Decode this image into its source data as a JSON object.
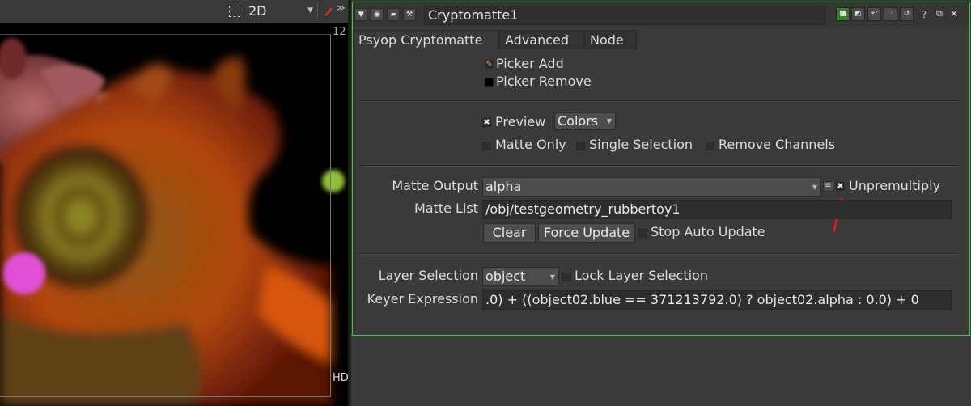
{
  "viewer": {
    "view_mode": "2D",
    "frame_top_label": "12",
    "frame_bottom_label": "HD"
  },
  "node": {
    "name": "Cryptomatte1",
    "accent_color": "#2bd32b",
    "help_label": "?"
  },
  "tabs": [
    {
      "label": "Psyop Cryptomatte",
      "active": true
    },
    {
      "label": "Advanced",
      "active": false
    },
    {
      "label": "Node",
      "active": false
    }
  ],
  "picker": {
    "add_label": "Picker Add",
    "add_checked": true,
    "remove_label": "Picker Remove",
    "remove_checked": false
  },
  "preview": {
    "label": "Preview",
    "checked": true,
    "mode_value": "Colors",
    "matte_only_label": "Matte Only",
    "single_selection_label": "Single Selection",
    "remove_channels_label": "Remove Channels"
  },
  "matte": {
    "output_label": "Matte Output",
    "output_value": "alpha",
    "unpremultiply_label": "Unpremultiply",
    "unpremultiply_checked": true,
    "list_label": "Matte List",
    "list_value": "/obj/testgeometry_rubbertoy1",
    "clear_label": "Clear",
    "force_update_label": "Force Update",
    "stop_auto_update_label": "Stop Auto Update"
  },
  "layer": {
    "selection_label": "Layer Selection",
    "selection_value": "object",
    "lock_label": "Lock Layer Selection",
    "keyer_label": "Keyer Expression",
    "keyer_value": ".0) + ((object02.blue == 371213792.0) ? object02.alpha : 0.0) + 0"
  }
}
